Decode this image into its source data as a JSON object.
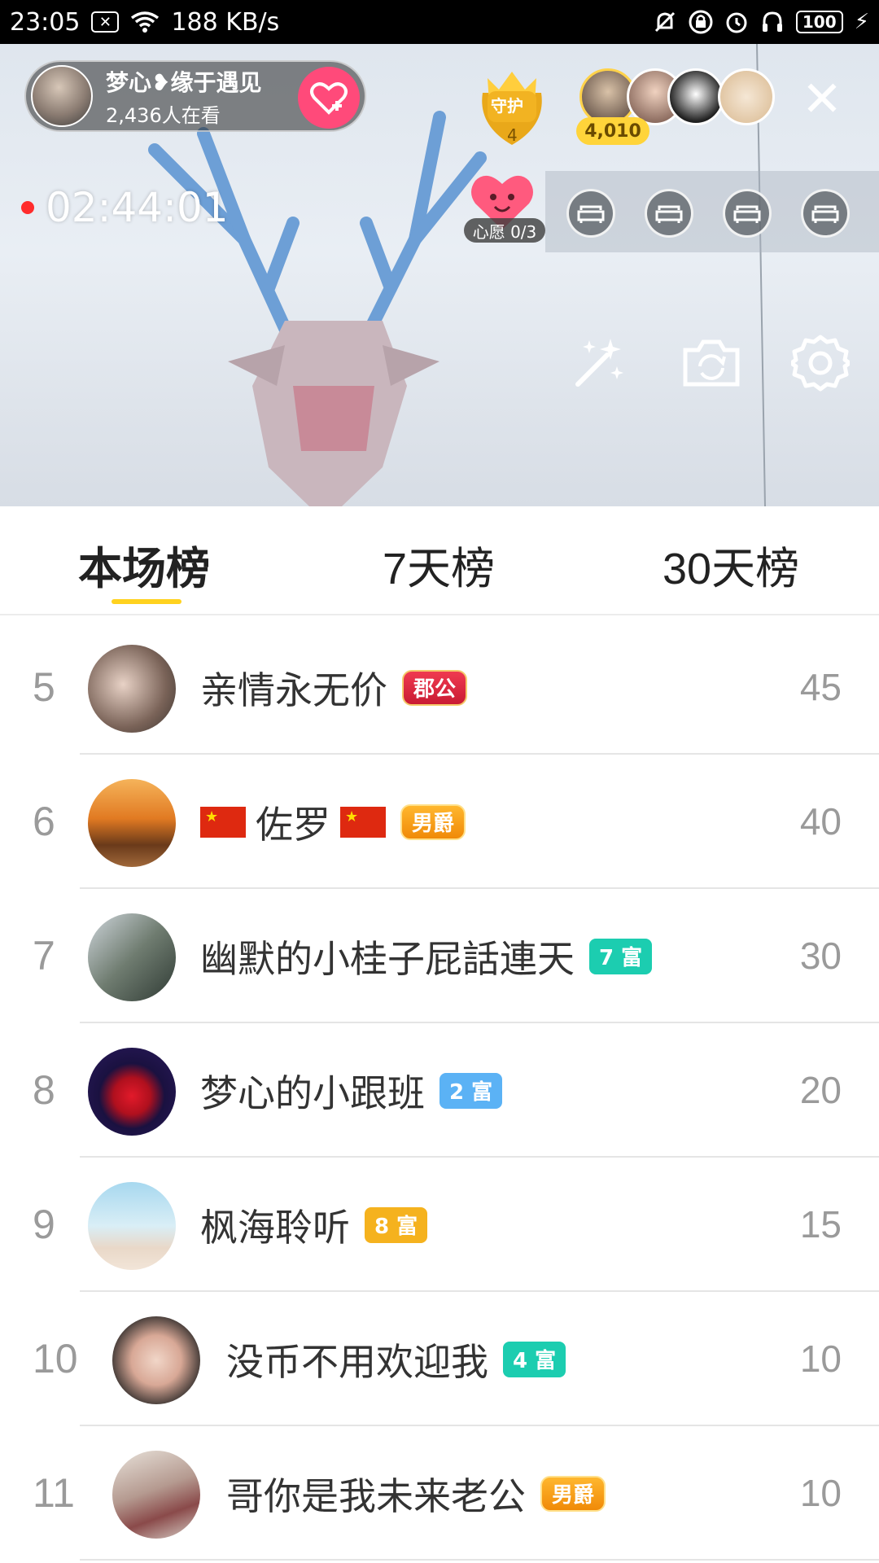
{
  "status_bar": {
    "time": "23:05",
    "network_speed": "188 KB/s",
    "battery": "100",
    "icons": [
      "close-box-icon",
      "wifi-icon",
      "mute-icon",
      "lock-icon",
      "alarm-icon",
      "headphones-icon",
      "charging-icon"
    ]
  },
  "live": {
    "host_name": "梦心❥缘于遇见",
    "viewers": "2,436人在看",
    "guard_label": "守护",
    "guard_count": "4",
    "fan_score": "4,010",
    "duration": "02:44:01",
    "wish_label": "心愿 0/3"
  },
  "tabs": [
    {
      "label": "本场榜",
      "active": true
    },
    {
      "label": "7天榜",
      "active": false
    },
    {
      "label": "30天榜",
      "active": false
    }
  ],
  "ranking": [
    {
      "rank": "5",
      "name": "亲情永无价",
      "badge": "郡公",
      "badge_style": "red",
      "score": "45"
    },
    {
      "rank": "6",
      "name": "佐罗",
      "flags": true,
      "badge": "男爵",
      "badge_style": "gold",
      "score": "40"
    },
    {
      "rank": "7",
      "name": "幽默的小桂子屁話連天",
      "badge": "7 富",
      "badge_style": "teal",
      "score": "30"
    },
    {
      "rank": "8",
      "name": "梦心的小跟班",
      "badge": "2 富",
      "badge_style": "blue",
      "score": "20"
    },
    {
      "rank": "9",
      "name": "枫海聆听",
      "badge": "8 富",
      "badge_style": "orange",
      "score": "15"
    },
    {
      "rank": "10",
      "name": "没币不用欢迎我",
      "badge": "4 富",
      "badge_style": "teal",
      "score": "10"
    },
    {
      "rank": "11",
      "name": "哥你是我未来老公",
      "badge": "男爵",
      "badge_style": "gold",
      "score": "10"
    }
  ],
  "colors": {
    "accent_yellow": "#ffd21f",
    "follow_pink": "#ff4a7a",
    "rec_red": "#ff2c2c",
    "rank_gray": "#9a9a9a"
  }
}
